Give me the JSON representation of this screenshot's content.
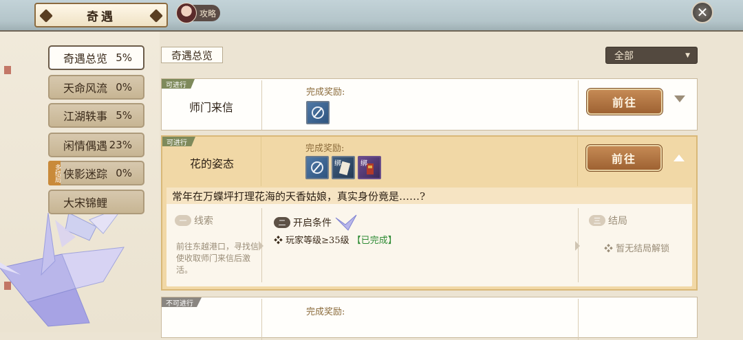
{
  "header": {
    "title": "奇遇",
    "guide_label": "攻略"
  },
  "sidebar": {
    "items": [
      {
        "label": "奇遇总览",
        "pct": "5%"
      },
      {
        "label": "天命风流",
        "pct": "0%"
      },
      {
        "label": "江湖轶事",
        "pct": "5%"
      },
      {
        "label": "闲情偶遇",
        "pct": "23%"
      },
      {
        "label": "侠影迷踪",
        "pct": "0%",
        "badge": "多结局"
      },
      {
        "label": "大宋锦鲤",
        "pct": ""
      }
    ]
  },
  "main": {
    "section_title": "奇遇总览",
    "filter": {
      "selected": "全部"
    },
    "quests": [
      {
        "status": "可进行",
        "name": "师门来信",
        "reward_label": "完成奖励:",
        "go_label": "前往"
      },
      {
        "status": "可进行",
        "name": "花的姿态",
        "reward_label": "完成奖励:",
        "go_label": "前往",
        "bind_label": "绑",
        "description": "常年在万蝶坪打理花海的天香姑娘，真实身份竟是……?",
        "clue": {
          "num": "一",
          "title": "线索",
          "text": "前往东越港口，寻找信使收取师门来信后激活。"
        },
        "condition": {
          "num": "二",
          "title": "开启条件",
          "item": "玩家等级≥35级",
          "state": "【已完成】"
        },
        "ending": {
          "num": "三",
          "title": "结局",
          "text": "暂无结局解锁"
        }
      },
      {
        "status": "不可进行",
        "reward_label": "完成奖励:"
      }
    ]
  },
  "colors": {
    "accent_button": "#b27443",
    "available_tag": "#7e8a5b",
    "completed_green": "#2e8b34"
  }
}
